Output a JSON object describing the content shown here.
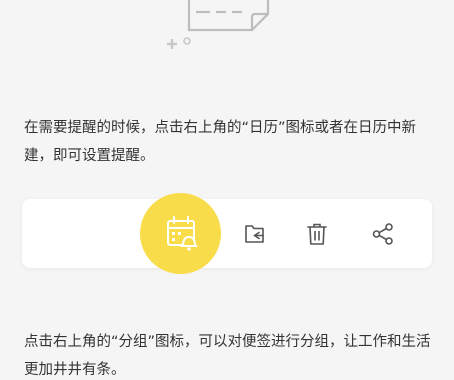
{
  "guide": {
    "paragraphs": [
      "在需要提醒的时候，点击右上角的“日历”图标或者在日历中新建，即可设置提醒。",
      "点击右上角的“分组”图标，可以对便签进行分组，让工作和生活更加井井有条。"
    ]
  },
  "illustration": {
    "icon": "sticky-note-icon",
    "decoration": "plus-circle-sparkle"
  },
  "toolbar": {
    "highlighted_icon": "calendar-bell-icon",
    "items": [
      {
        "icon": "calendar-bell-icon"
      },
      {
        "icon": "folder-group-icon"
      },
      {
        "icon": "trash-icon"
      },
      {
        "icon": "share-icon"
      }
    ]
  },
  "colors": {
    "background": "#f5f5f5",
    "card": "#ffffff",
    "accent_yellow": "#f9dc4a",
    "icon_gray": "#555555",
    "text": "#333333",
    "illustration_gray": "#bdbdbd"
  }
}
